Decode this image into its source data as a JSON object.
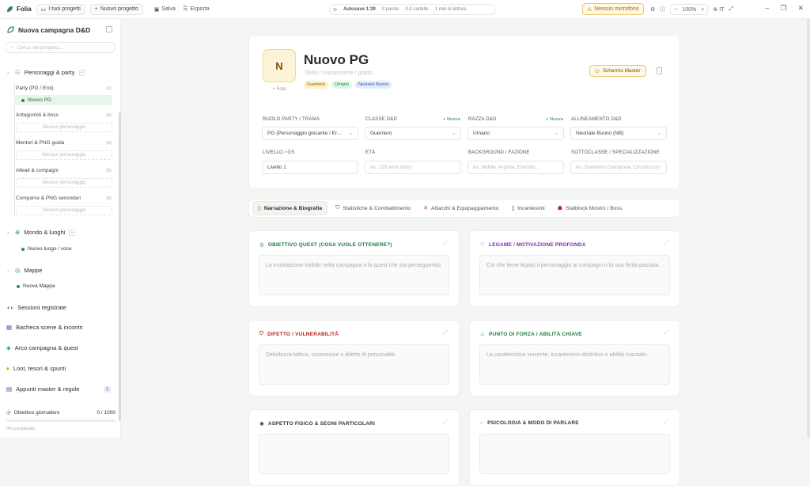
{
  "topbar": {
    "app_name": "Folia",
    "my_projects": "I tuoi progetti",
    "new_project": "Nuovo progetto",
    "save": "Salva",
    "export": "Esporta",
    "autosave": "Autosave 1:39",
    "words": "0 parole",
    "chars": "0.0 cartelle",
    "reading": "1 min di lettura",
    "mic": "Nessun microfono",
    "zoom": "100%",
    "lang": "IT"
  },
  "sidebar": {
    "title": "Nuova campagna D&D",
    "search_placeholder": "Cerca nel progetto...",
    "section_characters": "Personaggi & party",
    "groups": [
      {
        "label": "Party (PG / Eroi)",
        "count": "(1)",
        "item": "Nuovo PG"
      },
      {
        "label": "Antagonisti & boss",
        "count": "(0)",
        "empty": "Nessun personaggio"
      },
      {
        "label": "Mentori & PNG guida",
        "count": "(0)",
        "empty": "Nessun personaggio"
      },
      {
        "label": "Alleati & compagni",
        "count": "(0)",
        "empty": "Nessun personaggio"
      },
      {
        "label": "Comparse & PNG secondari",
        "count": "(0)",
        "empty": "Nessun personaggio"
      }
    ],
    "section_world": "Mondo & luoghi",
    "world_item": "Nuovo luogo / voce",
    "section_maps": "Mappe",
    "maps_item": "Nuova Mappa",
    "sessions": "Sessioni registrate",
    "scenes": "Bacheca scene & incontri",
    "arc": "Arco campagna & quest",
    "loot": "Loot, tesori & spunti",
    "notes": "Appunti master & regole",
    "notes_count": "1",
    "goal_label": "Obiettivo giornaliero",
    "goal_value": "0 / 1000",
    "goal_progress": 0,
    "goal_sub": "0% completato"
  },
  "header": {
    "avatar_letter": "N",
    "foto": "+ Foto",
    "name": "Nuovo PG",
    "subtitle_placeholder": "Titolo / soprannome / grado...",
    "badges": [
      "Guerriero",
      "Umano",
      "Neutrale Buono"
    ],
    "master_screen": "Schermo Master"
  },
  "fields": {
    "role_label": "RUOLO PARTY / TRAMA",
    "role_value": "PG (Personaggio giocante / Er...",
    "class_label": "CLASSE D&D",
    "class_value": "Guerriero",
    "race_label": "RAZZA D&D",
    "race_value": "Umano",
    "align_label": "ALLINEAMENTO D&D",
    "align_value": "Neutrale Buono (NB)",
    "nuova": "+ Nuova",
    "level_label": "LIVELLO / GS",
    "level_value": "Livello 1",
    "age_label": "ETÀ",
    "age_placeholder": "es. 120 anni (elfo)",
    "bg_label": "BACKGROUND / FAZIONE",
    "bg_placeholder": "es. Nobile, Arpista, Eremita...",
    "sub_label": "SOTTOCLASSE / SPECIALIZZAZIONE",
    "sub_placeholder": "es. Guerriero Campione, Circolo Lun"
  },
  "tabs": [
    "Narrazione & Biografia",
    "Statistiche & Combattimento",
    "Attacchi & Equipaggiamento",
    "Incantesimi",
    "Statblock Mostro / Boss"
  ],
  "cards": [
    {
      "title": "OBIETTIVO QUEST (COSA VUOLE OTTENERE?)",
      "placeholder": "La motivazione visibile nella campagna o la quest che sta perseguendo.",
      "color": "#1e7a40"
    },
    {
      "title": "LEGAME / MOTIVAZIONE PROFONDA",
      "placeholder": "Ciò che tiene legato il personaggio ai compagni o la sua ferita passata.",
      "color": "#6b2fa3"
    },
    {
      "title": "DIFETTO / VULNERABILITÀ",
      "placeholder": "Debolezza tattica, ossessione o difetto di personalità.",
      "color": "#b3261e"
    },
    {
      "title": "PUNTO DI FORZA / ABILITÀ CHIAVE",
      "placeholder": "La caratteristica vincente, incantesimo distintivo o abilità marziale.",
      "color": "#1e7a40"
    },
    {
      "title": "ASPETTO FISICO & SEGNI PARTICOLARI",
      "placeholder": "",
      "color": "#333333"
    },
    {
      "title": "PSICOLOGIA & MODO DI PARLARE",
      "placeholder": "",
      "color": "#333333"
    }
  ]
}
